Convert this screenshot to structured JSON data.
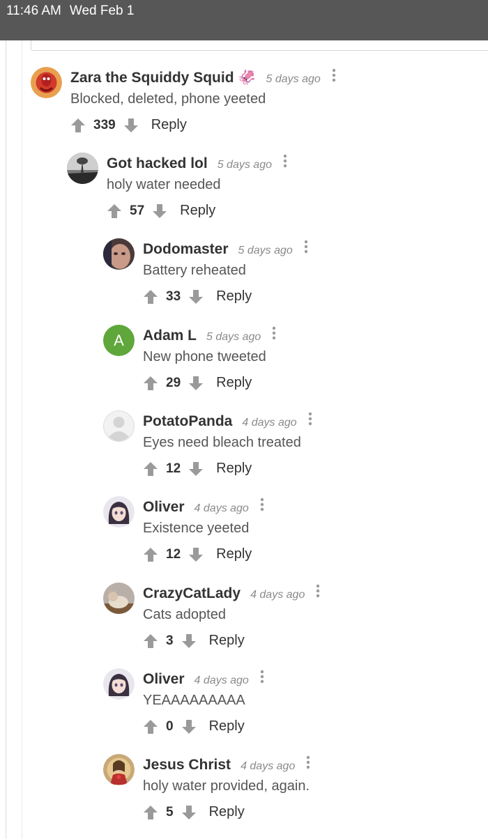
{
  "status_bar": {
    "time": "11:46 AM",
    "date": "Wed Feb 1"
  },
  "colors": {
    "status_bar_bg": "#575757",
    "vote_arrow": "#9a9a9a",
    "adam_avatar_bg": "#5fa63b"
  },
  "comments": [
    {
      "name": "Zara the Squiddy Squid 🦑",
      "time": "5 days ago",
      "text": "Blocked, deleted, phone yeeted",
      "votes": "339",
      "reply": "Reply",
      "avatar": "squid-avatar"
    },
    {
      "name": "Got hacked lol",
      "time": "5 days ago",
      "text": "holy water needed",
      "votes": "57",
      "reply": "Reply",
      "avatar": "landscape-avatar"
    },
    {
      "name": "Dodomaster",
      "time": "5 days ago",
      "text": "Battery reheated",
      "votes": "33",
      "reply": "Reply",
      "avatar": "face-avatar"
    },
    {
      "name": "Adam L",
      "time": "5 days ago",
      "text": "New phone tweeted",
      "votes": "29",
      "reply": "Reply",
      "avatar": "letter-avatar",
      "initial": "A"
    },
    {
      "name": "PotatoPanda",
      "time": "4 days ago",
      "text": "Eyes need bleach treated",
      "votes": "12",
      "reply": "Reply",
      "avatar": "default-avatar"
    },
    {
      "name": "Oliver",
      "time": "4 days ago",
      "text": "Existence yeeted",
      "votes": "12",
      "reply": "Reply",
      "avatar": "anime-avatar"
    },
    {
      "name": "CrazyCatLady",
      "time": "4 days ago",
      "text": "Cats adopted",
      "votes": "3",
      "reply": "Reply",
      "avatar": "cat-avatar"
    },
    {
      "name": "Oliver",
      "time": "4 days ago",
      "text": "YEAAAAAAAAA",
      "votes": "0",
      "reply": "Reply",
      "avatar": "anime-avatar"
    },
    {
      "name": "Jesus Christ",
      "time": "4 days ago",
      "text": "holy water provided, again.",
      "votes": "5",
      "reply": "Reply",
      "avatar": "jesus-avatar"
    }
  ]
}
